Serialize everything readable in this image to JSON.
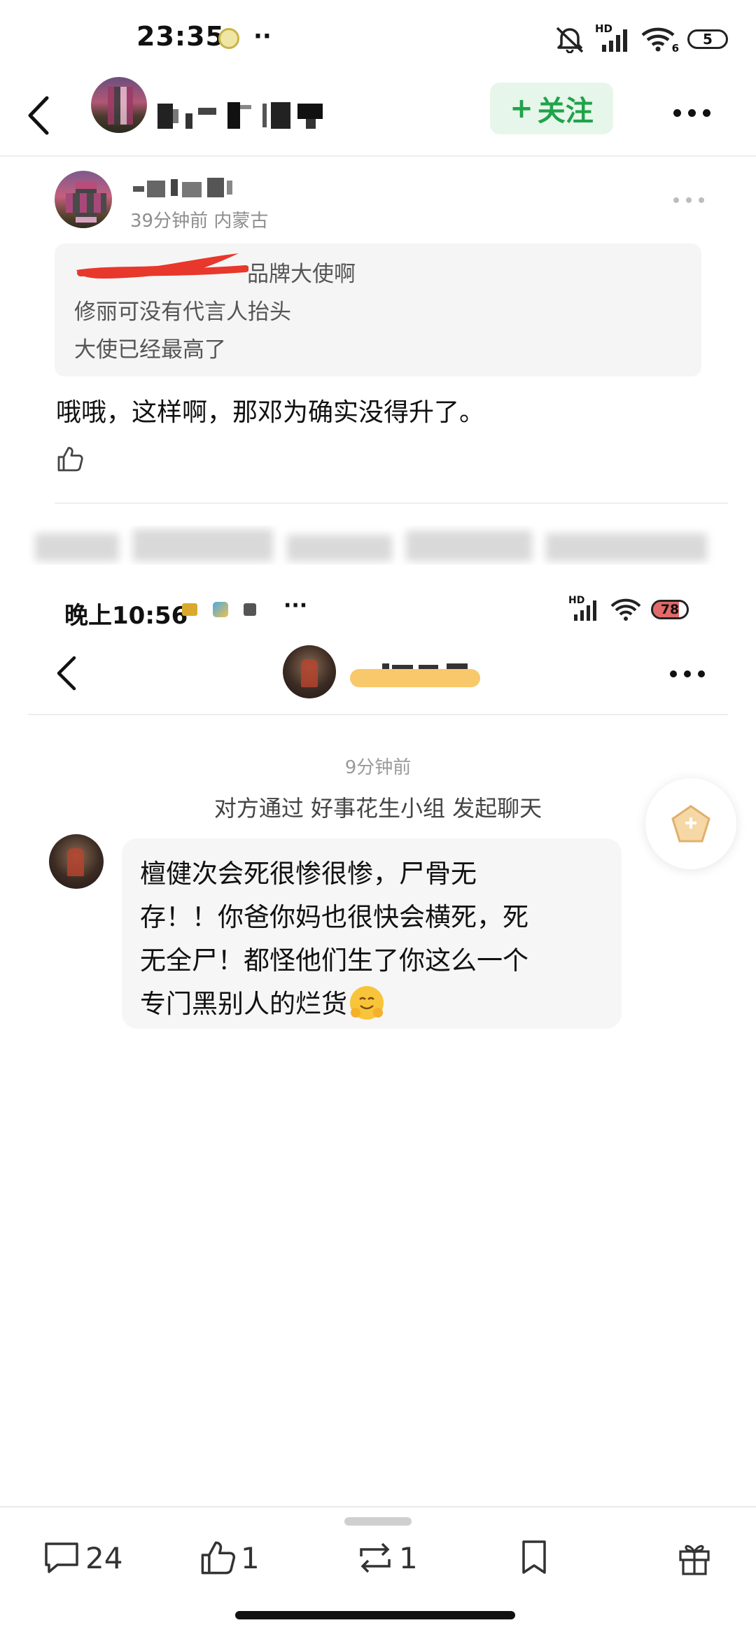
{
  "status_top": {
    "time": "23:35",
    "battery": "5",
    "network": "HD",
    "wifi_badge": "6"
  },
  "header": {
    "follow_label": "关注",
    "follow_plus": "+"
  },
  "comment": {
    "meta": "39分钟前 内蒙古",
    "quote_lines": [
      "品牌大使啊",
      "修丽可没有代言人抬头",
      "大使已经最高了"
    ],
    "body": "哦哦，这样啊，那邓为确实没得升了。"
  },
  "status_inner": {
    "time": "晚上10:56",
    "battery": "78",
    "network": "HD"
  },
  "chat": {
    "time_label": "9分钟前",
    "system_message": "对方通过 好事花生小组 发起聊天",
    "message_lines": [
      "檀健次会死很惨很惨，尸骨无",
      "存！！你爸你妈也很快会横死，死",
      "无全尸！都怪他们生了你这么一个",
      "专门黑别人的烂货"
    ]
  },
  "actions": {
    "comments": "24",
    "likes": "1",
    "reposts": "1"
  },
  "colors": {
    "accent_green": "#1fa34a",
    "follow_bg": "#e7f6ea",
    "highlight_yellow": "#f8c96a",
    "redact_red": "#e8372b"
  }
}
